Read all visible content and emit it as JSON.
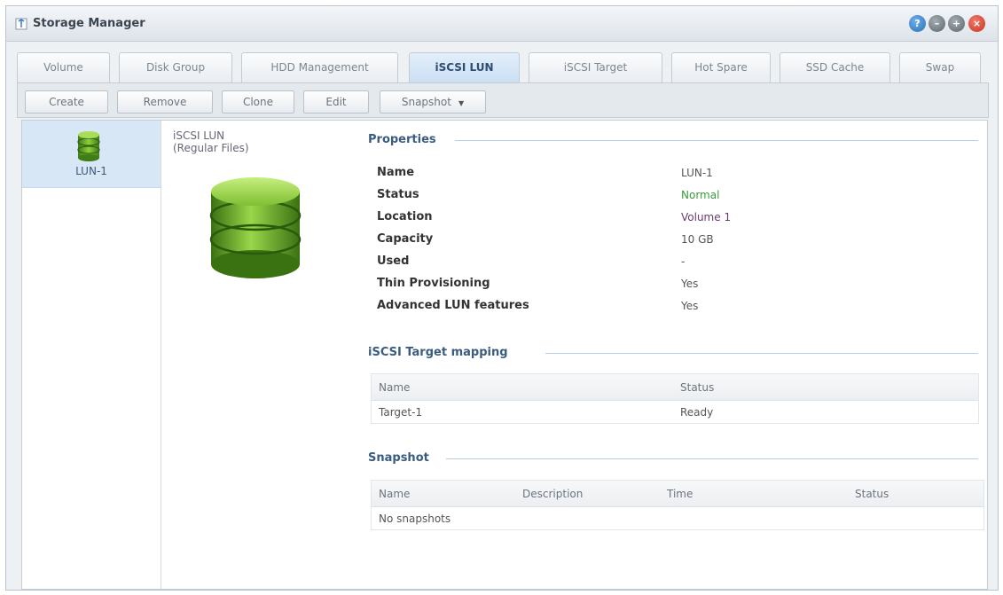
{
  "window": {
    "title": "Storage Manager",
    "controls": [
      "help-icon",
      "minimize-icon",
      "maximize-icon",
      "close-icon"
    ]
  },
  "tabs": [
    {
      "label": "Volume",
      "active": false
    },
    {
      "label": "Disk Group",
      "active": false
    },
    {
      "label": "HDD Management",
      "active": false
    },
    {
      "label": "iSCSI LUN",
      "active": true
    },
    {
      "label": "iSCSI Target",
      "active": false
    },
    {
      "label": "Hot Spare",
      "active": false
    },
    {
      "label": "SSD Cache",
      "active": false
    },
    {
      "label": "Swap",
      "active": false
    }
  ],
  "toolbar": {
    "create": "Create",
    "remove": "Remove",
    "clone": "Clone",
    "edit": "Edit",
    "snapshot": "Snapshot"
  },
  "sidebar": {
    "items": [
      {
        "label": "LUN-1",
        "icon": "database-icon",
        "selected": true
      }
    ]
  },
  "lun": {
    "type_line1": "iSCSI LUN",
    "type_line2": "(Regular Files)"
  },
  "properties": {
    "title": "Properties",
    "rows": [
      {
        "label": "Name",
        "value": "LUN-1"
      },
      {
        "label": "Status",
        "value": "Normal"
      },
      {
        "label": "Location",
        "value": "Volume 1"
      },
      {
        "label": "Capacity",
        "value": "10 GB"
      },
      {
        "label": "Used",
        "value": "-"
      },
      {
        "label": "Thin Provisioning",
        "value": "Yes"
      },
      {
        "label": "Advanced LUN features",
        "value": "Yes"
      }
    ]
  },
  "mapping": {
    "title": "iSCSI Target mapping",
    "columns": [
      "Name",
      "Status"
    ],
    "rows": [
      {
        "name": "Target-1",
        "status": "Ready"
      }
    ]
  },
  "snapshot": {
    "title": "Snapshot",
    "columns": [
      "Name",
      "Description",
      "Time",
      "Status"
    ],
    "empty": "No snapshots"
  },
  "colors": {
    "accent": "#3b5c7e",
    "status_ok": "#3d9a3d",
    "selection": "#d8e7f5"
  }
}
